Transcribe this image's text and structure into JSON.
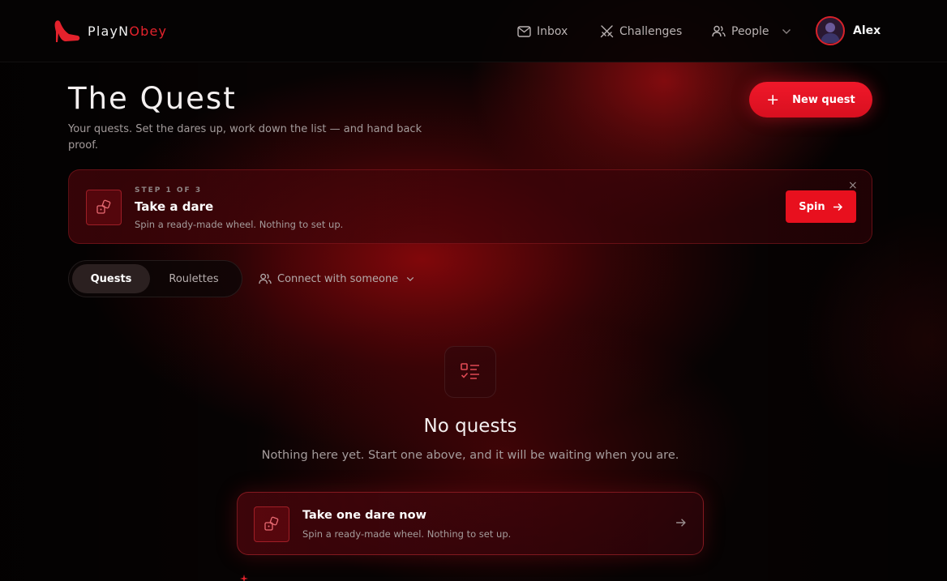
{
  "brand": {
    "name_part1": "PlayN",
    "name_part2": "Obey",
    "accent_color": "#e3222c"
  },
  "nav": {
    "inbox": {
      "label": "Inbox",
      "icon": "mail-icon"
    },
    "challenges": {
      "label": "Challenges",
      "icon": "crossed-swords-icon"
    },
    "people": {
      "label": "People",
      "icon": "users-icon"
    }
  },
  "user": {
    "name": "Alex"
  },
  "hero": {
    "title": "The Quest",
    "subtitle": "Your quests. Set the dares up, work down the list — and hand back proof.",
    "new_quest_label": "New quest"
  },
  "step_card": {
    "step_label": "STEP 1 OF 3",
    "title": "Take a dare",
    "description": "Spin a ready-made wheel. Nothing to set up.",
    "button_label": "Spin",
    "close_symbol": "×"
  },
  "tabs": [
    {
      "label": "Quests",
      "active": true
    },
    {
      "label": "Roulettes",
      "active": false
    }
  ],
  "connect": {
    "label": "Connect with someone"
  },
  "empty_state": {
    "title": "No quests",
    "description": "Nothing here yet. Start one above, and it will be waiting when you are."
  },
  "dare_card": {
    "title": "Take one dare now",
    "description": "Spin a ready-made wheel. Nothing to set up."
  },
  "colors": {
    "primary_red": "#e8101e",
    "background": "#060303"
  }
}
